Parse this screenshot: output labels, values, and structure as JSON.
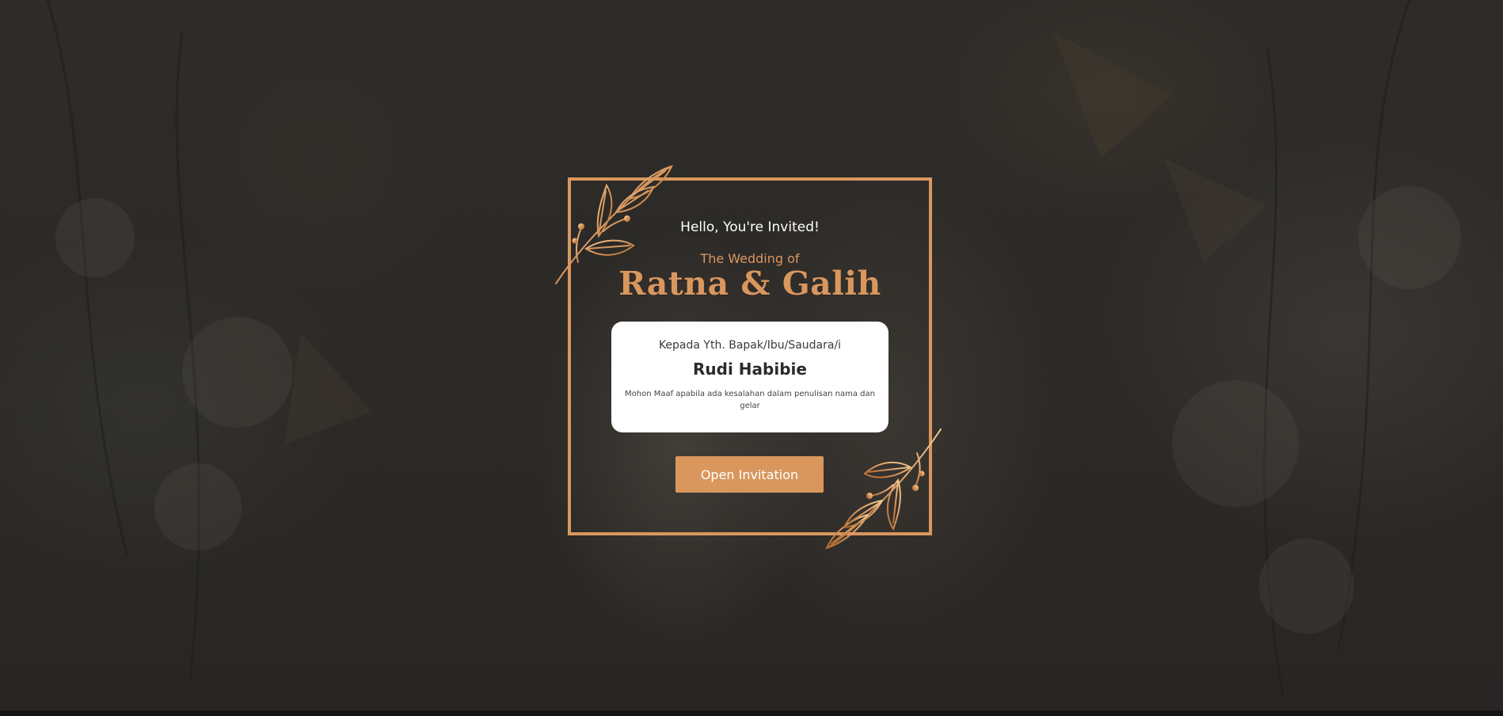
{
  "colors": {
    "accent": "#d9975e",
    "card": "#ffffff",
    "text_dark": "#2b2b2b"
  },
  "invitation": {
    "greeting": "Hello, You're Invited!",
    "subtitle": "The Wedding of",
    "couple_names": "Ratna & Galih"
  },
  "guest": {
    "salutation": "Kepada Yth. Bapak/Ibu/Saudara/i",
    "name": "Rudi Habibie",
    "note": "Mohon Maaf apabila ada kesalahan dalam penulisan nama dan gelar"
  },
  "actions": {
    "open_label": "Open Invitation"
  },
  "decor": {
    "background": "couple-photo-backdrop",
    "top_ornament": "golden-leaf-branch-icon",
    "bottom_ornament": "golden-leaf-branch-icon"
  }
}
